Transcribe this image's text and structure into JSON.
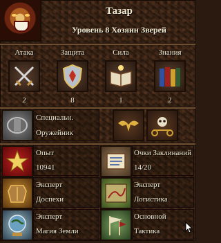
{
  "hero": {
    "name": "Тазар",
    "level_line": "Уровень 8 Хозяин Зверей"
  },
  "primary_skills": [
    {
      "label": "Атака",
      "value": "2",
      "icon": "crossed-swords-icon"
    },
    {
      "label": "Защита",
      "value": "8",
      "icon": "shield-icon"
    },
    {
      "label": "Сила",
      "value": "1",
      "icon": "spellbook-icon"
    },
    {
      "label": "Знания",
      "value": "2",
      "icon": "books-icon"
    }
  ],
  "specialty": {
    "label": "Специальн.",
    "value": "Оружейник",
    "icon": "armor-icon"
  },
  "artifacts": [
    {
      "icon": "eagle-icon"
    },
    {
      "icon": "skull-scales-icon"
    }
  ],
  "experience": {
    "label": "Опыт",
    "value": "10941",
    "icon": "star-medal-icon"
  },
  "spell_points": {
    "label": "Очки Заклинаний",
    "value": "14/20",
    "icon": "scroll-icon"
  },
  "secondary_skills": [
    {
      "level": "Эксперт",
      "name": "Доспехи",
      "icon": "armor-icon"
    },
    {
      "level": "Эксперт",
      "name": "Логистика",
      "icon": "map-icon"
    },
    {
      "level": "Эксперт",
      "name": "Магия Земли",
      "icon": "earth-orb-icon"
    },
    {
      "level": "Основной",
      "name": "Тактика",
      "icon": "flags-icon"
    }
  ],
  "colors": {
    "background": "#2a1a10",
    "text": "#f4ecd2"
  }
}
